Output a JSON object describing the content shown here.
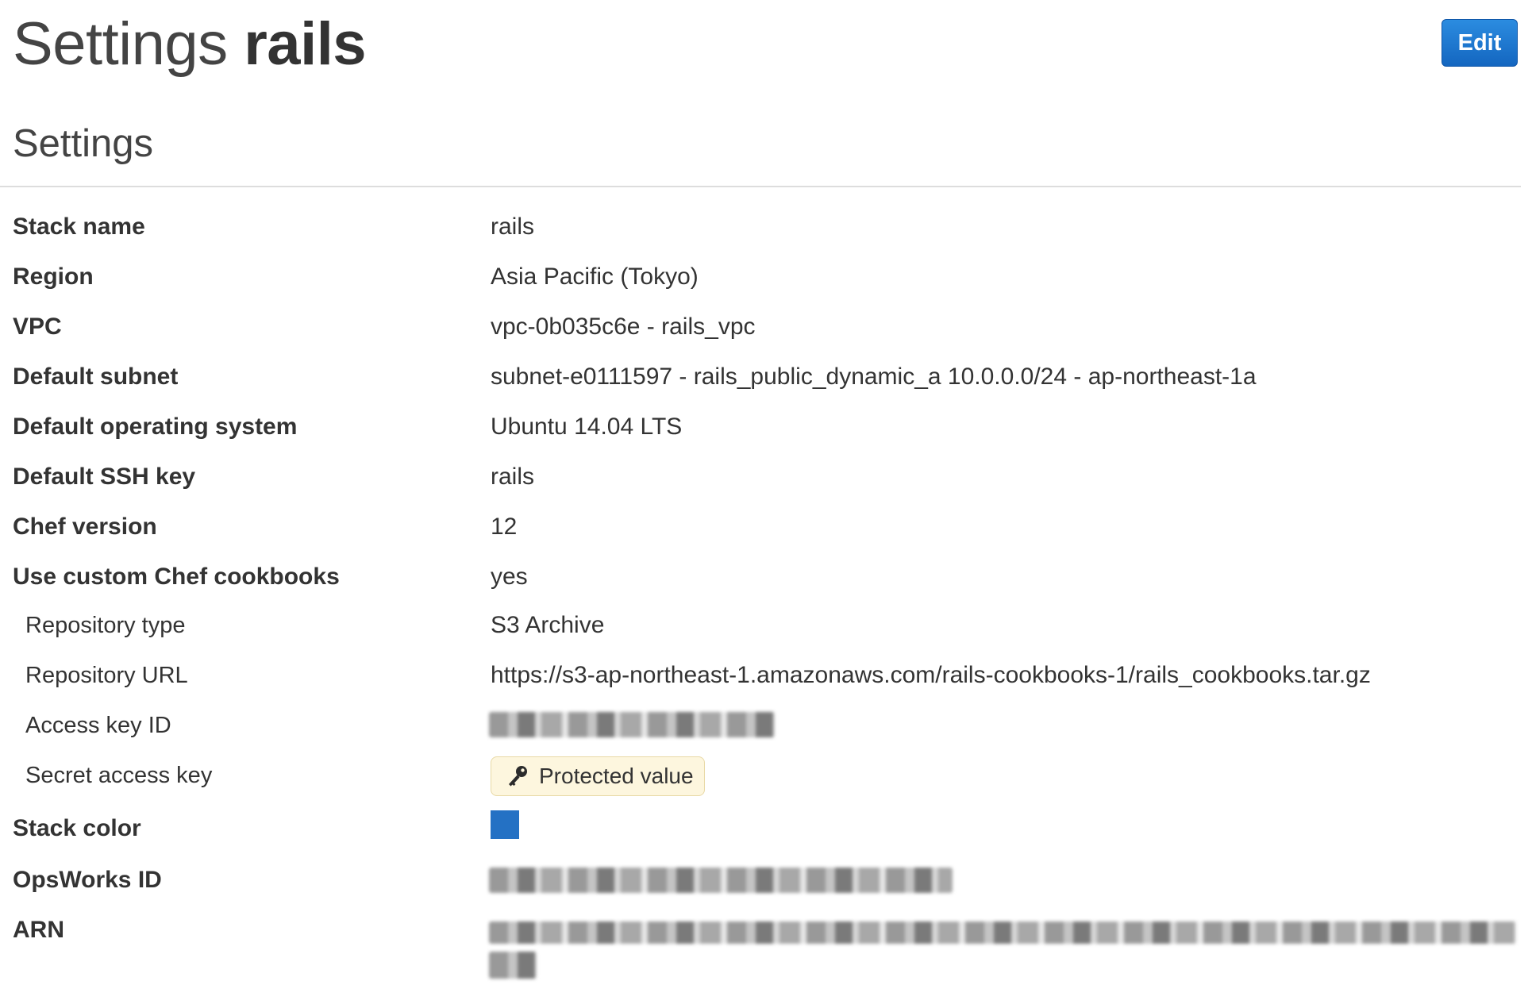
{
  "header": {
    "title_prefix": "Settings",
    "title_name": "rails",
    "edit_label": "Edit"
  },
  "section_title": "Settings",
  "rows": {
    "stack_name": {
      "label": "Stack name",
      "value": "rails"
    },
    "region": {
      "label": "Region",
      "value": "Asia Pacific (Tokyo)"
    },
    "vpc": {
      "label": "VPC",
      "value": "vpc-0b035c6e - rails_vpc"
    },
    "default_subnet": {
      "label": "Default subnet",
      "value": "subnet-e0111597 - rails_public_dynamic_a 10.0.0.0/24 - ap-northeast-1a"
    },
    "default_os": {
      "label": "Default operating system",
      "value": "Ubuntu 14.04 LTS"
    },
    "default_ssh_key": {
      "label": "Default SSH key",
      "value": "rails"
    },
    "chef_version": {
      "label": "Chef version",
      "value": "12"
    },
    "custom_cookbooks": {
      "label": "Use custom Chef cookbooks",
      "value": "yes"
    },
    "repo_type": {
      "label": "Repository type",
      "value": "S3 Archive"
    },
    "repo_url": {
      "label": "Repository URL",
      "value": "https://s3-ap-northeast-1.amazonaws.com/rails-cookbooks-1/rails_cookbooks.tar.gz"
    },
    "access_key_id": {
      "label": "Access key ID"
    },
    "secret_access_key": {
      "label": "Secret access key",
      "value": "Protected value",
      "icon": "key-icon"
    },
    "stack_color": {
      "label": "Stack color",
      "color": "#2471c4"
    },
    "opsworks_id": {
      "label": "OpsWorks ID"
    },
    "arn": {
      "label": "ARN"
    }
  },
  "colors": {
    "edit_button": "#1a73d0",
    "protected_bg": "#fdf6de",
    "text": "#333333"
  }
}
